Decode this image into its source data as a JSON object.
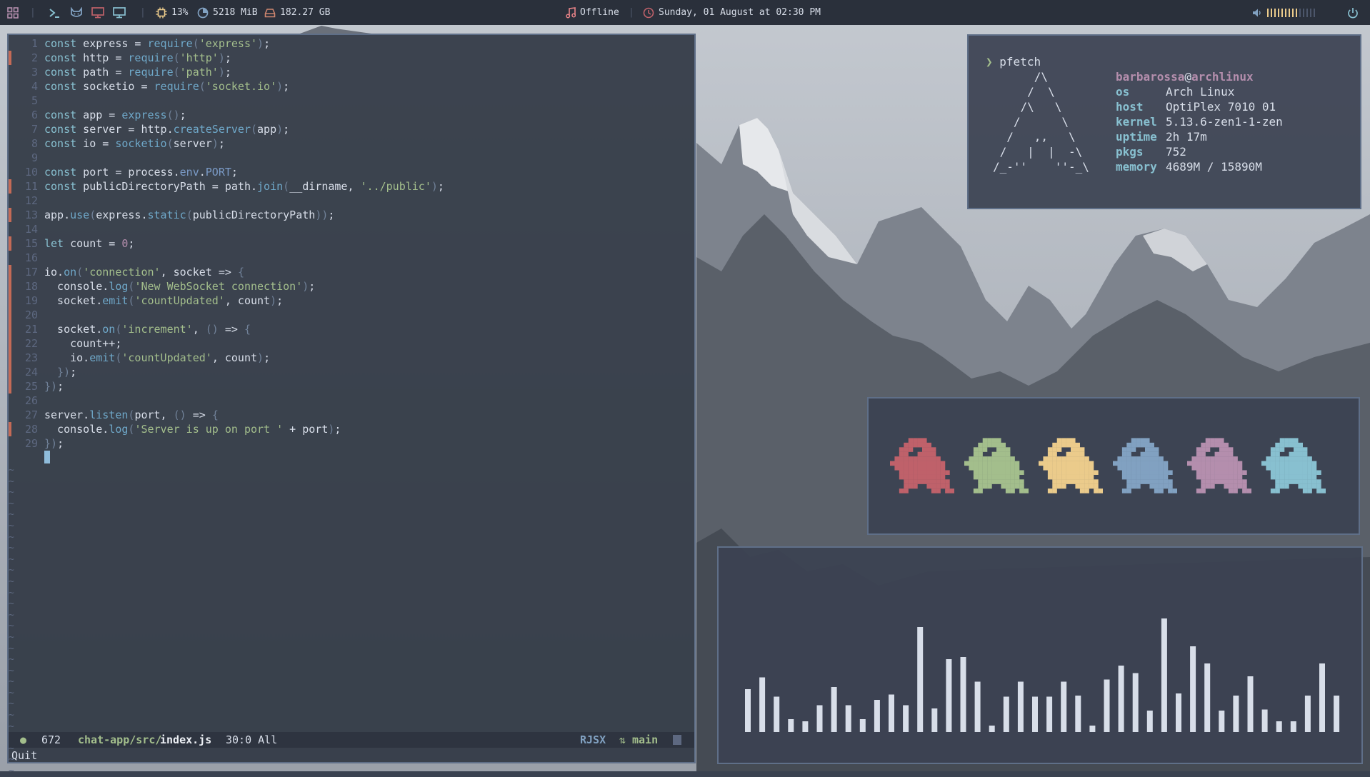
{
  "colors": {
    "bar_bg": "#2a303b",
    "fg": "#d8dee9",
    "accent_cyan": "#88c0d0",
    "green": "#a3be8c",
    "yellow": "#ebcb8b",
    "red": "#bf616a",
    "purple": "#b48ead",
    "blue": "#81a1c1",
    "teal": "#8fbcbb",
    "pink": "#e88388",
    "border": "#5f6f88"
  },
  "topbar": {
    "left_icons": [
      "workspaces-grid-icon",
      "terminal-icon",
      "cat-icon",
      "monitor-icon",
      "display-icon"
    ],
    "cpu": "13%",
    "memory": "5218 MiB",
    "disk": "182.27 GB",
    "music": "Offline",
    "datetime": "Sunday, 01 August at 02:30 PM",
    "volume_level": 0.65
  },
  "editor": {
    "lines": [
      {
        "n": "1",
        "g": false,
        "code": [
          [
            "k",
            "const"
          ],
          [
            "t",
            " express = "
          ],
          [
            "f",
            "require"
          ],
          [
            "p",
            "("
          ],
          [
            "s",
            "'express'"
          ],
          [
            "p",
            ")"
          ],
          [
            "t",
            ";"
          ]
        ]
      },
      {
        "n": "2",
        "g": true,
        "code": [
          [
            "k",
            "const"
          ],
          [
            "t",
            " http = "
          ],
          [
            "f",
            "require"
          ],
          [
            "p",
            "("
          ],
          [
            "s",
            "'http'"
          ],
          [
            "p",
            ")"
          ],
          [
            "t",
            ";"
          ]
        ]
      },
      {
        "n": "3",
        "g": false,
        "code": [
          [
            "k",
            "const"
          ],
          [
            "t",
            " path = "
          ],
          [
            "f",
            "require"
          ],
          [
            "p",
            "("
          ],
          [
            "s",
            "'path'"
          ],
          [
            "p",
            ")"
          ],
          [
            "t",
            ";"
          ]
        ]
      },
      {
        "n": "4",
        "g": false,
        "code": [
          [
            "k",
            "const"
          ],
          [
            "t",
            " socketio = "
          ],
          [
            "f",
            "require"
          ],
          [
            "p",
            "("
          ],
          [
            "s",
            "'socket.io'"
          ],
          [
            "p",
            ")"
          ],
          [
            "t",
            ";"
          ]
        ]
      },
      {
        "n": "5",
        "g": false,
        "code": []
      },
      {
        "n": "6",
        "g": false,
        "code": [
          [
            "k",
            "const"
          ],
          [
            "t",
            " app = "
          ],
          [
            "f",
            "express"
          ],
          [
            "p",
            "()"
          ],
          [
            "t",
            ";"
          ]
        ]
      },
      {
        "n": "7",
        "g": false,
        "code": [
          [
            "k",
            "const"
          ],
          [
            "t",
            " server = http."
          ],
          [
            "f",
            "createServer"
          ],
          [
            "p",
            "("
          ],
          [
            "t",
            "app"
          ],
          [
            "p",
            ")"
          ],
          [
            "t",
            ";"
          ]
        ]
      },
      {
        "n": "8",
        "g": false,
        "code": [
          [
            "k",
            "const"
          ],
          [
            "t",
            " io = "
          ],
          [
            "f",
            "socketio"
          ],
          [
            "p",
            "("
          ],
          [
            "t",
            "server"
          ],
          [
            "p",
            ")"
          ],
          [
            "t",
            ";"
          ]
        ]
      },
      {
        "n": "9",
        "g": false,
        "code": []
      },
      {
        "n": "10",
        "g": false,
        "code": [
          [
            "k",
            "const"
          ],
          [
            "t",
            " port = process."
          ],
          [
            "v",
            "env"
          ],
          [
            "t",
            "."
          ],
          [
            "v",
            "PORT"
          ],
          [
            "t",
            ";"
          ]
        ]
      },
      {
        "n": "11",
        "g": true,
        "code": [
          [
            "k",
            "const"
          ],
          [
            "t",
            " publicDirectoryPath = path."
          ],
          [
            "f",
            "join"
          ],
          [
            "p",
            "("
          ],
          [
            "t",
            "__dirname, "
          ],
          [
            "s",
            "'../public'"
          ],
          [
            "p",
            ")"
          ],
          [
            "t",
            ";"
          ]
        ]
      },
      {
        "n": "12",
        "g": false,
        "code": []
      },
      {
        "n": "13",
        "g": true,
        "code": [
          [
            "t",
            "app."
          ],
          [
            "f",
            "use"
          ],
          [
            "p",
            "("
          ],
          [
            "t",
            "express."
          ],
          [
            "f",
            "static"
          ],
          [
            "p",
            "("
          ],
          [
            "t",
            "publicDirectoryPath"
          ],
          [
            "p",
            "))"
          ],
          [
            "t",
            ";"
          ]
        ]
      },
      {
        "n": "14",
        "g": false,
        "code": []
      },
      {
        "n": "15",
        "g": true,
        "code": [
          [
            "k",
            "let"
          ],
          [
            "t",
            " count = "
          ],
          [
            "n",
            "0"
          ],
          [
            "t",
            ";"
          ]
        ]
      },
      {
        "n": "16",
        "g": false,
        "code": []
      },
      {
        "n": "17",
        "g": true,
        "code": [
          [
            "t",
            "io."
          ],
          [
            "f",
            "on"
          ],
          [
            "p",
            "("
          ],
          [
            "s",
            "'connection'"
          ],
          [
            "t",
            ", socket => "
          ],
          [
            "p",
            "{"
          ]
        ]
      },
      {
        "n": "18",
        "g": true,
        "code": [
          [
            "t",
            "  console."
          ],
          [
            "f",
            "log"
          ],
          [
            "p",
            "("
          ],
          [
            "s",
            "'New WebSocket connection'"
          ],
          [
            "p",
            ")"
          ],
          [
            "t",
            ";"
          ]
        ]
      },
      {
        "n": "19",
        "g": true,
        "code": [
          [
            "t",
            "  socket."
          ],
          [
            "f",
            "emit"
          ],
          [
            "p",
            "("
          ],
          [
            "s",
            "'countUpdated'"
          ],
          [
            "t",
            ", count"
          ],
          [
            "p",
            ")"
          ],
          [
            "t",
            ";"
          ]
        ]
      },
      {
        "n": "20",
        "g": true,
        "code": []
      },
      {
        "n": "21",
        "g": true,
        "code": [
          [
            "t",
            "  socket."
          ],
          [
            "f",
            "on"
          ],
          [
            "p",
            "("
          ],
          [
            "s",
            "'increment'"
          ],
          [
            "t",
            ", "
          ],
          [
            "p",
            "()"
          ],
          [
            "t",
            " => "
          ],
          [
            "p",
            "{"
          ]
        ]
      },
      {
        "n": "22",
        "g": true,
        "code": [
          [
            "t",
            "    count++;"
          ]
        ]
      },
      {
        "n": "23",
        "g": true,
        "code": [
          [
            "t",
            "    io."
          ],
          [
            "f",
            "emit"
          ],
          [
            "p",
            "("
          ],
          [
            "s",
            "'countUpdated'"
          ],
          [
            "t",
            ", count"
          ],
          [
            "p",
            ")"
          ],
          [
            "t",
            ";"
          ]
        ]
      },
      {
        "n": "24",
        "g": true,
        "code": [
          [
            "p",
            "  })"
          ],
          [
            "t",
            ";"
          ]
        ]
      },
      {
        "n": "25",
        "g": true,
        "code": [
          [
            "p",
            "})"
          ],
          [
            "t",
            ";"
          ]
        ]
      },
      {
        "n": "26",
        "g": false,
        "code": []
      },
      {
        "n": "27",
        "g": false,
        "code": [
          [
            "t",
            "server."
          ],
          [
            "f",
            "listen"
          ],
          [
            "p",
            "("
          ],
          [
            "t",
            "port, "
          ],
          [
            "p",
            "()"
          ],
          [
            "t",
            " => "
          ],
          [
            "p",
            "{"
          ]
        ]
      },
      {
        "n": "28",
        "g": true,
        "code": [
          [
            "t",
            "  console."
          ],
          [
            "f",
            "log"
          ],
          [
            "p",
            "("
          ],
          [
            "s",
            "'Server is up on port '"
          ],
          [
            "t",
            " + port"
          ],
          [
            "p",
            ")"
          ],
          [
            "t",
            ";"
          ]
        ]
      },
      {
        "n": "29",
        "g": false,
        "code": [
          [
            "p",
            "})"
          ],
          [
            "t",
            ";"
          ]
        ]
      }
    ],
    "tilde_count": 28,
    "status": {
      "count": "672",
      "path_dir": "chat-app/src/",
      "path_file": "index.js",
      "position": "30:0 All",
      "filetype": "RJSX",
      "branch": "main"
    },
    "command": "Quit"
  },
  "pfetch": {
    "prompt_symbol": "❯",
    "command": "pfetch",
    "art": "      /\\\n     /  \\\n    /\\   \\\n   /      \\\n  /   ,,   \\\n /   |  |  -\\\n/_-''    ''-_\\",
    "user": "barbarossa",
    "at": "@",
    "host": "archlinux",
    "info": [
      {
        "key": "os",
        "value": "Arch Linux"
      },
      {
        "key": "host",
        "value": "OptiPlex 7010 01"
      },
      {
        "key": "kernel",
        "value": "5.13.6-zen1-1-zen"
      },
      {
        "key": "uptime",
        "value": "2h 17m"
      },
      {
        "key": "pkgs",
        "value": "752"
      },
      {
        "key": "memory",
        "value": "4689M / 15890M"
      }
    ]
  },
  "ghosts": {
    "colors": [
      "#bf616a",
      "#a3be8c",
      "#ebcb8b",
      "#81a1c1",
      "#b48ead",
      "#88c0d0"
    ]
  },
  "visualizer": {
    "bar_color": "#d8dee9",
    "levels": [
      0.4,
      0.51,
      0.33,
      0.12,
      0.1,
      0.25,
      0.42,
      0.25,
      0.12,
      0.3,
      0.35,
      0.25,
      0.98,
      0.22,
      0.68,
      0.7,
      0.47,
      0.06,
      0.33,
      0.47,
      0.33,
      0.33,
      0.47,
      0.34,
      0.06,
      0.49,
      0.62,
      0.55,
      0.2,
      1.06,
      0.36,
      0.8,
      0.64,
      0.2,
      0.34,
      0.52,
      0.21,
      0.1,
      0.1,
      0.34,
      0.64,
      0.34
    ]
  }
}
